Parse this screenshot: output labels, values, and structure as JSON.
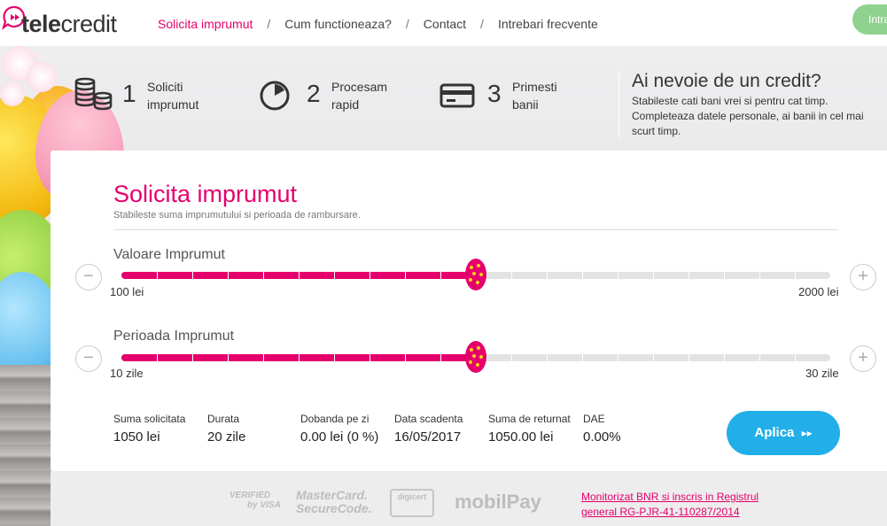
{
  "brand": {
    "name_bold": "tele",
    "name_light": "credit"
  },
  "nav": {
    "items": [
      "Solicita imprumut",
      "Cum functioneaza?",
      "Contact",
      "Intrebari frecvente"
    ],
    "separator": "/",
    "login_label": "Intra"
  },
  "steps": [
    {
      "num": "1",
      "line1": "Soliciti",
      "line2": "imprumut",
      "icon": "coins-icon"
    },
    {
      "num": "2",
      "line1": "Procesam",
      "line2": "rapid",
      "icon": "clock-icon"
    },
    {
      "num": "3",
      "line1": "Primesti",
      "line2": "banii",
      "icon": "card-icon"
    }
  ],
  "promo": {
    "title": "Ai nevoie de un credit?",
    "text": "Stabileste cati bani vrei si pentru cat timp. Completeaza datele personale, ai banii in cel mai scurt timp."
  },
  "form": {
    "title": "Solicita imprumut",
    "subtitle": "Stabileste suma imprumutului si perioada de rambursare.",
    "amount": {
      "label": "Valoare Imprumut",
      "min": "100 lei",
      "max": "2000 lei",
      "level": 0.5,
      "minus": "−",
      "plus": "+"
    },
    "period": {
      "label": "Perioada Imprumut",
      "min": "10 zile",
      "max": "30 zile",
      "level": 0.5,
      "minus": "−",
      "plus": "+"
    }
  },
  "summary": [
    {
      "label": "Suma solicitata",
      "value": "1050 lei"
    },
    {
      "label": "Durata",
      "value": "20 zile"
    },
    {
      "label": "Dobanda pe zi",
      "value": "0.00 lei (0 %)"
    },
    {
      "label": "Data scadenta",
      "value": "16/05/2017"
    },
    {
      "label": "Suma de returnat",
      "value": "1050.00 lei"
    },
    {
      "label": "DAE",
      "value": "0.00%"
    }
  ],
  "apply": {
    "label": "Aplica",
    "arrow": "▸▸"
  },
  "footer": {
    "badges": {
      "visa_line1": "VERIFIED",
      "visa_line2": "by VISA",
      "mc_line1": "MasterCard.",
      "mc_line2": "SecureCode.",
      "digicert": "digicert",
      "mobilpay": "mobilPay"
    },
    "bnr_line1": "Monitorizat BNR si inscris in Registrul",
    "bnr_line2": "general RG-PJR-41-110287/2014"
  },
  "colors": {
    "accent": "#e5006d",
    "button": "#22aee8",
    "login": "#8fd28f"
  }
}
